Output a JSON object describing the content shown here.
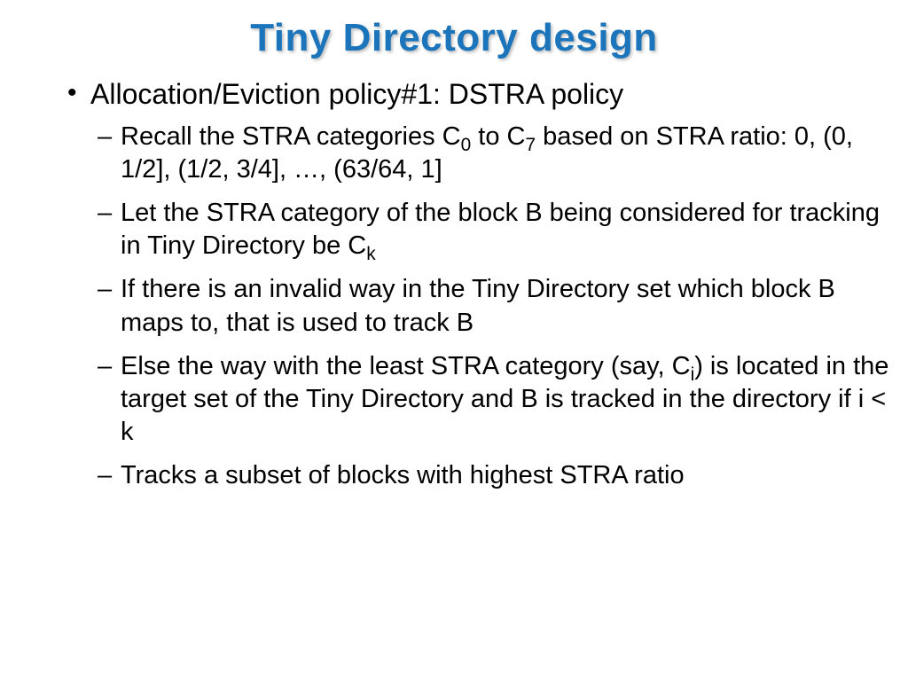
{
  "title": "Tiny Directory design",
  "l1": "Allocation/Eviction policy#1: DSTRA policy",
  "l2a_pre": "Recall the STRA categories C",
  "l2a_sub1": "0",
  "l2a_mid": " to C",
  "l2a_sub2": "7",
  "l2a_post": " based on STRA ratio: 0, (0, 1/2], (1/2, 3/4], …, (63/64, 1]",
  "l2b_pre": "Let the STRA category of the block B being considered for tracking in Tiny Directory be C",
  "l2b_sub": "k",
  "l2c": "If there is an invalid way in the Tiny Directory set which block B maps to, that is used to track B",
  "l2d_pre": "Else the way with the least STRA category (say, C",
  "l2d_sub": "i",
  "l2d_post": ") is located in the target set of the Tiny Directory and B is tracked in the directory if i < k",
  "l2e": "Tracks a subset of blocks with highest STRA ratio"
}
